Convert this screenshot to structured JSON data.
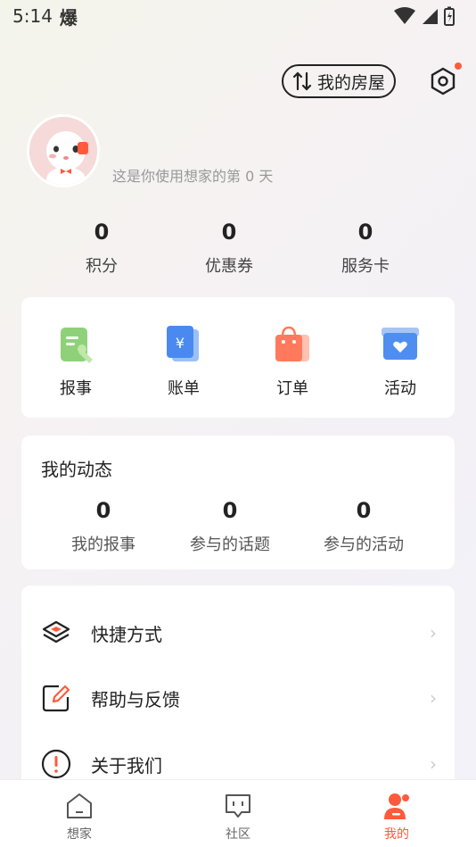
{
  "status": {
    "time": "5:14",
    "app_glyph": "爆"
  },
  "header": {
    "house_label": "我的房屋"
  },
  "profile": {
    "days_text": "这是你使用想家的第 0 天"
  },
  "stats": [
    {
      "value": "0",
      "label": "积分"
    },
    {
      "value": "0",
      "label": "优惠券"
    },
    {
      "value": "0",
      "label": "服务卡"
    }
  ],
  "shortcuts": [
    {
      "label": "报事",
      "icon": "report-icon"
    },
    {
      "label": "账单",
      "icon": "bill-icon"
    },
    {
      "label": "订单",
      "icon": "order-icon"
    },
    {
      "label": "活动",
      "icon": "activity-icon"
    }
  ],
  "dynamics": {
    "title": "我的动态",
    "items": [
      {
        "value": "0",
        "label": "我的报事"
      },
      {
        "value": "0",
        "label": "参与的话题"
      },
      {
        "value": "0",
        "label": "参与的活动"
      }
    ]
  },
  "menu": [
    {
      "label": "快捷方式",
      "icon": "layers-icon"
    },
    {
      "label": "帮助与反馈",
      "icon": "edit-icon"
    },
    {
      "label": "关于我们",
      "icon": "info-icon"
    }
  ],
  "tabbar": [
    {
      "label": "想家",
      "icon": "home-icon"
    },
    {
      "label": "社区",
      "icon": "community-icon"
    },
    {
      "label": "我的",
      "icon": "profile-icon"
    }
  ],
  "colors": {
    "accent": "#ff5a3c"
  }
}
